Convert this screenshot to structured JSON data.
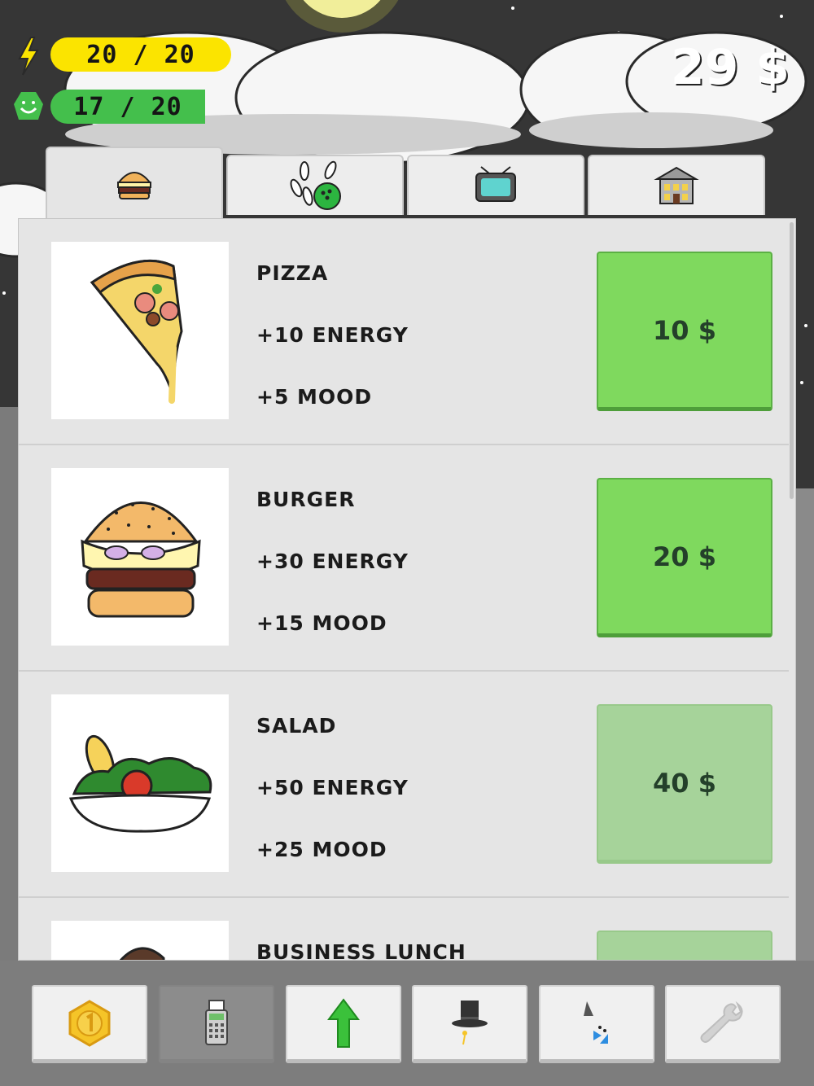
{
  "hud": {
    "energy": "20 / 20",
    "mood": "17 / 20",
    "money": "29 $"
  },
  "tabs": [
    {
      "name": "food",
      "icon": "burger-icon",
      "active": true
    },
    {
      "name": "fun",
      "icon": "bowling-icon",
      "active": false
    },
    {
      "name": "tv",
      "icon": "tv-icon",
      "active": false
    },
    {
      "name": "housing",
      "icon": "house-icon",
      "active": false
    }
  ],
  "items": [
    {
      "name": "PIZZA",
      "energy": "+10 ENERGY",
      "mood": "+5 MOOD",
      "price": "10 $",
      "affordable": true,
      "image": "pizza-icon"
    },
    {
      "name": "BURGER",
      "energy": "+30 ENERGY",
      "mood": "+15 MOOD",
      "price": "20 $",
      "affordable": true,
      "image": "burger-icon"
    },
    {
      "name": "SALAD",
      "energy": "+50 ENERGY",
      "mood": "+25 MOOD",
      "price": "40 $",
      "affordable": false,
      "image": "salad-icon"
    },
    {
      "name": "BUSINESS LUNCH",
      "affordable": false,
      "image": "business-lunch-icon"
    }
  ],
  "toolbar": [
    {
      "icon": "coin-icon",
      "selected": false
    },
    {
      "icon": "cash-register-icon",
      "selected": true
    },
    {
      "icon": "green-up-arrow-icon",
      "selected": false
    },
    {
      "icon": "top-hat-icon",
      "selected": false
    },
    {
      "icon": "party-hat-icon",
      "selected": false
    },
    {
      "icon": "wrench-icon",
      "selected": false
    }
  ],
  "colors": {
    "energy_bar": "#fbe400",
    "mood_bar": "#44bf4c",
    "buy_enabled": "#7fd95e",
    "buy_disabled": "#a6d39a",
    "sky": "#333333"
  }
}
